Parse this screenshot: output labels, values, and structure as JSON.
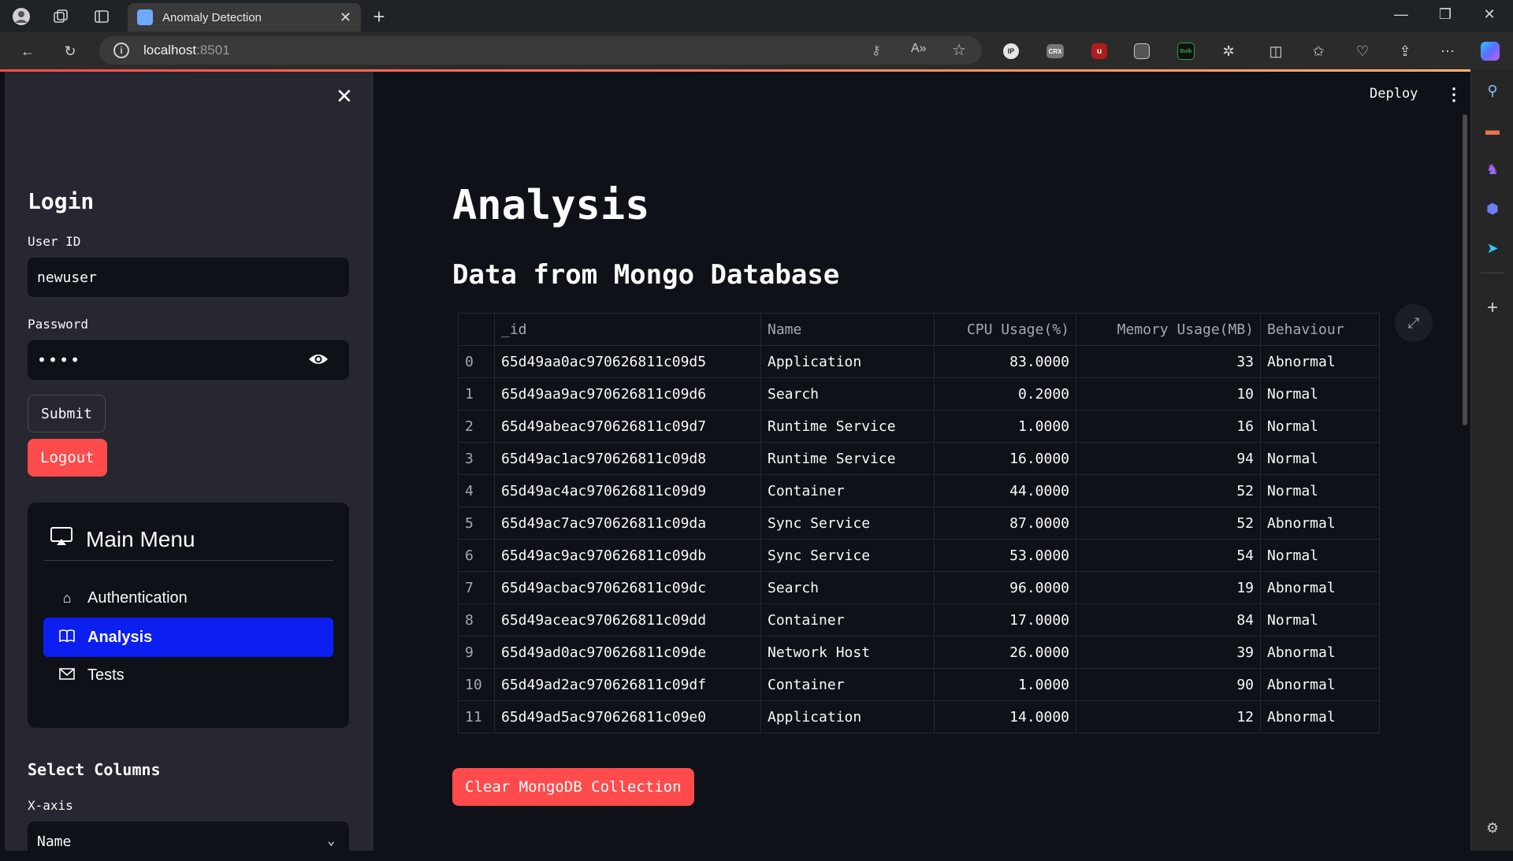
{
  "browser": {
    "tab_title": "Anomaly Detection",
    "url_host": "localhost",
    "url_port": ":8501",
    "tab_close": "✕",
    "new_tab": "+"
  },
  "sidebar": {
    "login_heading": "Login",
    "user_id_label": "User ID",
    "user_id_value": "newuser",
    "password_label": "Password",
    "password_value": "••••",
    "submit_label": "Submit",
    "logout_label": "Logout",
    "menu_title": "Main Menu",
    "menu_items": [
      {
        "label": "Authentication",
        "icon": "house-icon",
        "active": false
      },
      {
        "label": "Analysis",
        "icon": "book-icon",
        "active": true
      },
      {
        "label": "Tests",
        "icon": "envelope-icon",
        "active": false
      }
    ],
    "select_columns_heading": "Select Columns",
    "xaxis_label": "X-axis",
    "xaxis_value": "Name"
  },
  "main": {
    "deploy_label": "Deploy",
    "title": "Analysis",
    "subtitle": "Data from Mongo Database",
    "clear_button": "Clear MongoDB Collection"
  },
  "table": {
    "headers": [
      "",
      "_id",
      "Name",
      "CPU Usage(%)",
      "Memory Usage(MB)",
      "Behaviour"
    ],
    "rows": [
      [
        "0",
        "65d49aa0ac970626811c09d5",
        "Application",
        "83.0000",
        "33",
        "Abnormal"
      ],
      [
        "1",
        "65d49aa9ac970626811c09d6",
        "Search",
        "0.2000",
        "10",
        "Normal"
      ],
      [
        "2",
        "65d49abeac970626811c09d7",
        "Runtime Service",
        "1.0000",
        "16",
        "Normal"
      ],
      [
        "3",
        "65d49ac1ac970626811c09d8",
        "Runtime Service",
        "16.0000",
        "94",
        "Normal"
      ],
      [
        "4",
        "65d49ac4ac970626811c09d9",
        "Container",
        "44.0000",
        "52",
        "Normal"
      ],
      [
        "5",
        "65d49ac7ac970626811c09da",
        "Sync Service",
        "87.0000",
        "52",
        "Abnormal"
      ],
      [
        "6",
        "65d49ac9ac970626811c09db",
        "Sync Service",
        "53.0000",
        "54",
        "Normal"
      ],
      [
        "7",
        "65d49acbac970626811c09dc",
        "Search",
        "96.0000",
        "19",
        "Abnormal"
      ],
      [
        "8",
        "65d49aceac970626811c09dd",
        "Container",
        "17.0000",
        "84",
        "Normal"
      ],
      [
        "9",
        "65d49ad0ac970626811c09de",
        "Network Host",
        "26.0000",
        "39",
        "Abnormal"
      ],
      [
        "10",
        "65d49ad2ac970626811c09df",
        "Container",
        "1.0000",
        "90",
        "Abnormal"
      ],
      [
        "11",
        "65d49ad5ac970626811c09e0",
        "Application",
        "14.0000",
        "12",
        "Abnormal"
      ]
    ]
  },
  "colors": {
    "accent_red": "#ff4b4b",
    "active_menu": "#0b1ff0",
    "sidebar_bg": "#262730",
    "main_bg": "#0e1117"
  }
}
